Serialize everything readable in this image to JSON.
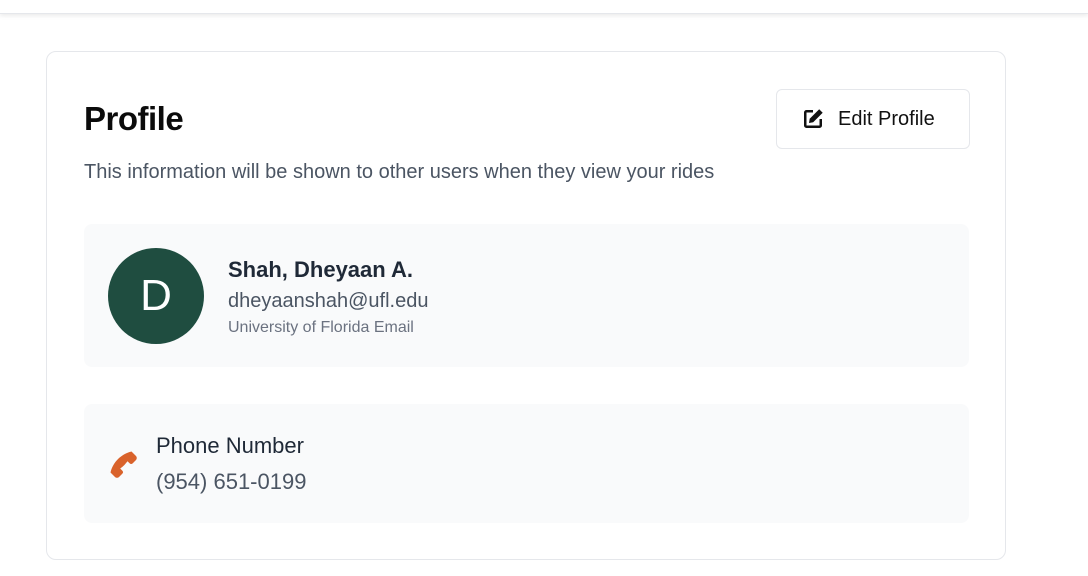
{
  "profile": {
    "title": "Profile",
    "subtitle": "This information will be shown to other users when they view your rides",
    "edit_button": {
      "label": "Edit Profile",
      "icon": "edit-icon"
    }
  },
  "user": {
    "avatar_initial": "D",
    "avatar_color": "#1f4d40",
    "name": "Shah, Dheyaan A.",
    "email": "dheyaanshah@ufl.edu",
    "email_note": "University of Florida Email"
  },
  "phone": {
    "icon": "phone-icon",
    "icon_color": "#d9622b",
    "label": "Phone Number",
    "value": "(954) 651-0199"
  }
}
